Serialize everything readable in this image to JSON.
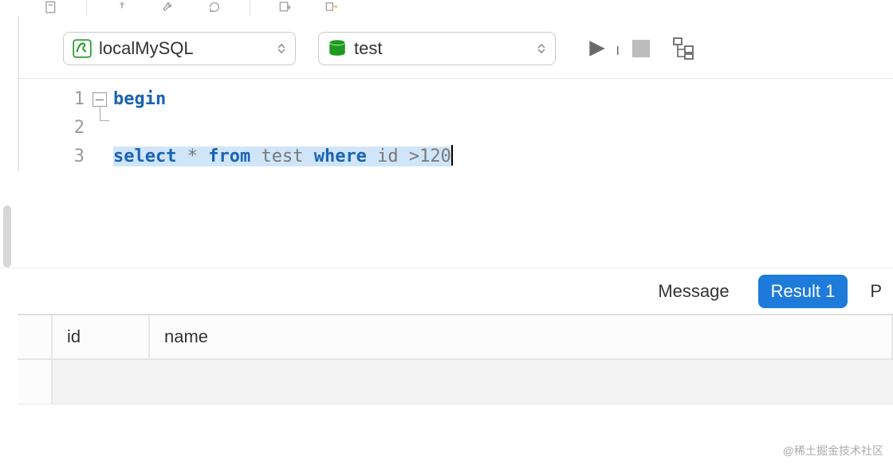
{
  "toolbar_top": {
    "icons": [
      "document-icon",
      "pin-icon",
      "wrench-icon",
      "refresh-icon",
      "list-down-icon",
      "export-icon"
    ]
  },
  "connection": {
    "label": "localMySQL",
    "icon": "mysql-icon"
  },
  "database": {
    "label": "test",
    "icon": "database-icon"
  },
  "run": {
    "play": "play-icon",
    "stop": "stop-icon",
    "explain": "explain-plan-icon"
  },
  "editor": {
    "lines": [
      {
        "n": 1,
        "tokens": [
          {
            "t": "begin",
            "c": "kw"
          }
        ]
      },
      {
        "n": 2,
        "tokens": []
      },
      {
        "n": 3,
        "selected": true,
        "tokens": [
          {
            "t": "select",
            "c": "kw2"
          },
          {
            "t": " * ",
            "c": "op"
          },
          {
            "t": "from",
            "c": "kw2"
          },
          {
            "t": " test ",
            "c": "ident"
          },
          {
            "t": "where",
            "c": "kw2"
          },
          {
            "t": " id ",
            "c": "ident"
          },
          {
            "t": ">",
            "c": "op"
          },
          {
            "t": "120",
            "c": "num"
          }
        ]
      }
    ]
  },
  "result_tabs": {
    "message": "Message",
    "result1": "Result 1",
    "partial": "P",
    "active": "result1"
  },
  "table": {
    "columns": [
      "id",
      "name"
    ],
    "rows": []
  },
  "watermark": "@稀土掘金技术社区"
}
